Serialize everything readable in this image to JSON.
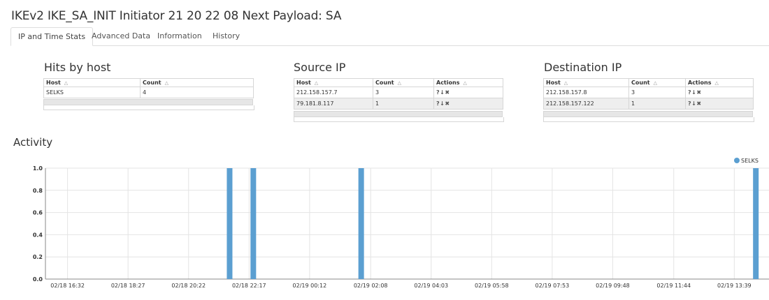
{
  "page_title": "IKEv2 IKE_SA_INIT Initiator 21 20 22 08 Next Payload: SA",
  "tabs": [
    {
      "label": "IP and Time Stats",
      "active": true
    },
    {
      "label": "Advanced Data",
      "active": false
    },
    {
      "label": "Information",
      "active": false
    },
    {
      "label": "History",
      "active": false
    }
  ],
  "hits_by_host": {
    "title": "Hits by host",
    "columns": [
      "Host",
      "Count"
    ],
    "rows": [
      [
        "SELKS",
        "4"
      ]
    ]
  },
  "source_ip": {
    "title": "Source IP",
    "columns": [
      "Host",
      "Count",
      "Actions"
    ],
    "rows": [
      [
        "212.158.157.7",
        "3"
      ],
      [
        "79.181.8.117",
        "1"
      ]
    ]
  },
  "destination_ip": {
    "title": "Destination IP",
    "columns": [
      "Host",
      "Count",
      "Actions"
    ],
    "rows": [
      [
        "212.158.157.8",
        "3"
      ],
      [
        "212.158.157.122",
        "1"
      ]
    ]
  },
  "action_icons": [
    "question-circle-icon",
    "download-arrow-icon",
    "close-icon"
  ],
  "activity": {
    "title": "Activity"
  },
  "chart_data": {
    "type": "bar",
    "title": "",
    "xlabel": "",
    "ylabel": "",
    "ylim": [
      0,
      1.0
    ],
    "yticks": [
      "0.0",
      "0.2",
      "0.4",
      "0.6",
      "0.8",
      "1.0"
    ],
    "x_tick_labels": [
      "02/18 16:32",
      "02/18 18:27",
      "02/18 20:22",
      "02/18 22:17",
      "02/19 00:12",
      "02/19 02:08",
      "02/19 04:03",
      "02/19 05:58",
      "02/19 07:53",
      "02/19 09:48",
      "02/19 11:44",
      "02/19 13:39"
    ],
    "x_range": [
      "02/18 15:50",
      "02/19 14:45"
    ],
    "series": [
      {
        "name": "SELKS",
        "color": "#5b9fd1",
        "points": [
          {
            "x": "02/18 21:40",
            "y": 1
          },
          {
            "x": "02/18 22:25",
            "y": 1
          },
          {
            "x": "02/19 01:50",
            "y": 1
          },
          {
            "x": "02/19 14:20",
            "y": 1
          }
        ]
      }
    ],
    "grid": true,
    "legend_position": "top-right"
  }
}
